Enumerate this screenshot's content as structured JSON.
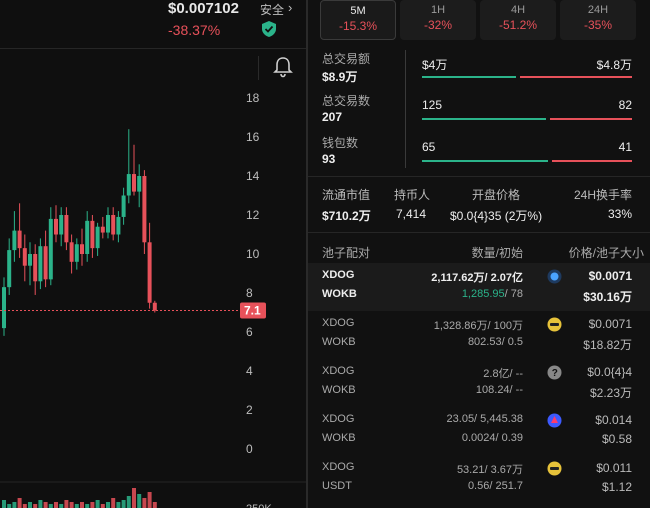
{
  "header": {
    "price": "$0.007102",
    "change": "-38.37%",
    "safety_label": "安全",
    "safety_arrow": "›"
  },
  "chart_data": {
    "type": "candlestick",
    "ylabels": [
      "18",
      "16",
      "14",
      "12",
      "10",
      "8",
      "6",
      "4",
      "2",
      "0"
    ],
    "current_price_label": "7.1",
    "bottom_partial_label": "250K",
    "candles": [
      {
        "o": 6.2,
        "h": 8.8,
        "l": 5.8,
        "c": 8.3
      },
      {
        "o": 8.3,
        "h": 10.8,
        "l": 7.9,
        "c": 10.2
      },
      {
        "o": 10.2,
        "h": 12.2,
        "l": 9.6,
        "c": 11.2
      },
      {
        "o": 11.2,
        "h": 12.6,
        "l": 9.8,
        "c": 10.3
      },
      {
        "o": 10.3,
        "h": 11.0,
        "l": 8.6,
        "c": 9.4
      },
      {
        "o": 9.4,
        "h": 10.6,
        "l": 8.4,
        "c": 10.0
      },
      {
        "o": 10.0,
        "h": 10.5,
        "l": 7.9,
        "c": 8.6
      },
      {
        "o": 8.6,
        "h": 10.8,
        "l": 8.2,
        "c": 10.4
      },
      {
        "o": 10.4,
        "h": 11.2,
        "l": 8.3,
        "c": 8.7
      },
      {
        "o": 8.7,
        "h": 12.4,
        "l": 8.4,
        "c": 11.8
      },
      {
        "o": 11.8,
        "h": 12.5,
        "l": 10.6,
        "c": 11.0
      },
      {
        "o": 11.0,
        "h": 12.4,
        "l": 10.4,
        "c": 12.0
      },
      {
        "o": 12.0,
        "h": 12.4,
        "l": 10.2,
        "c": 10.6
      },
      {
        "o": 10.6,
        "h": 11.0,
        "l": 9.0,
        "c": 9.6
      },
      {
        "o": 9.6,
        "h": 10.8,
        "l": 9.2,
        "c": 10.5
      },
      {
        "o": 10.5,
        "h": 11.3,
        "l": 9.4,
        "c": 10.0
      },
      {
        "o": 10.0,
        "h": 12.2,
        "l": 9.6,
        "c": 11.7
      },
      {
        "o": 11.7,
        "h": 12.0,
        "l": 9.8,
        "c": 10.3
      },
      {
        "o": 10.3,
        "h": 11.6,
        "l": 9.9,
        "c": 11.4
      },
      {
        "o": 11.4,
        "h": 11.9,
        "l": 10.8,
        "c": 11.1
      },
      {
        "o": 11.1,
        "h": 12.4,
        "l": 10.8,
        "c": 12.0
      },
      {
        "o": 12.0,
        "h": 12.4,
        "l": 10.7,
        "c": 11.0
      },
      {
        "o": 11.0,
        "h": 12.2,
        "l": 10.6,
        "c": 11.9
      },
      {
        "o": 11.9,
        "h": 13.4,
        "l": 11.5,
        "c": 13.0
      },
      {
        "o": 13.0,
        "h": 16.4,
        "l": 12.6,
        "c": 14.1
      },
      {
        "o": 14.1,
        "h": 15.6,
        "l": 13.0,
        "c": 13.2
      },
      {
        "o": 13.2,
        "h": 14.6,
        "l": 12.4,
        "c": 14.0
      },
      {
        "o": 14.0,
        "h": 14.3,
        "l": 10.0,
        "c": 10.6
      },
      {
        "o": 10.6,
        "h": 11.6,
        "l": 7.2,
        "c": 7.5
      },
      {
        "o": 7.5,
        "h": 7.6,
        "l": 7.0,
        "c": 7.1
      }
    ],
    "volumes": [
      0.4,
      0.2,
      0.3,
      0.5,
      0.2,
      0.3,
      0.2,
      0.4,
      0.3,
      0.2,
      0.3,
      0.2,
      0.4,
      0.3,
      0.2,
      0.3,
      0.2,
      0.3,
      0.4,
      0.2,
      0.3,
      0.5,
      0.3,
      0.4,
      0.6,
      1.0,
      0.7,
      0.5,
      0.8,
      0.3
    ]
  },
  "tabs": [
    {
      "label": "5M",
      "value": "-15.3%"
    },
    {
      "label": "1H",
      "value": "-32%"
    },
    {
      "label": "4H",
      "value": "-51.2%"
    },
    {
      "label": "24H",
      "value": "-35%"
    }
  ],
  "stats": {
    "volume_label": "总交易额",
    "volume_value": "$8.9万",
    "tx_label": "总交易数",
    "tx_value": "207",
    "wallet_label": "钱包数",
    "wallet_value": "93",
    "volume_buy": "$4万",
    "volume_sell": "$4.8万",
    "tx_buy": "125",
    "tx_sell": "82",
    "wallet_buy": "65",
    "wallet_sell": "41",
    "buy_ratios": [
      0.455,
      0.604,
      0.613
    ]
  },
  "info": {
    "circulating_label": "流通市值",
    "circulating_value": "$710.2万",
    "holders_label": "持币人",
    "holders_value": "7,414",
    "open_label": "开盘价格",
    "open_value": "$0.0{4}35 (2万%)",
    "turnover_label": "24H换手率",
    "turnover_value": "33%"
  },
  "pools": {
    "header_pair": "池子配对",
    "header_qty": "数量/初始",
    "header_price": "价格/池子大小",
    "rows": [
      {
        "a": "XDOG",
        "b": "WOKB",
        "qa": "2,117.62万/ 2.07亿",
        "qb_green": "1,285.95",
        "qb_rest": "/ 78",
        "price": "$0.0071",
        "size": "$30.16万",
        "icon": "dex-icon-1",
        "highlight": true
      },
      {
        "a": "XDOG",
        "b": "WOKB",
        "qa": "1,328.86万/ 100万",
        "qb_green": "",
        "qb_rest": "802.53/ 0.5",
        "price": "$0.0071",
        "size": "$18.82万",
        "icon": "dex-icon-2",
        "highlight": false
      },
      {
        "a": "XDOG",
        "b": "WOKB",
        "qa": "2.8亿/ --",
        "qb_green": "",
        "qb_rest": "108.24/ --",
        "price": "$0.0{4}4",
        "size": "$2.23万",
        "icon": "question-icon",
        "highlight": false
      },
      {
        "a": "XDOG",
        "b": "WOKB",
        "qa": "23.05/ 5,445.38",
        "qb_green": "",
        "qb_rest": "0.0024/ 0.39",
        "price": "$0.014",
        "size": "$0.58",
        "icon": "dex-icon-3",
        "highlight": false
      },
      {
        "a": "XDOG",
        "b": "USDT",
        "qa": "53.21/ 3.67万",
        "qb_green": "",
        "qb_rest": "0.56/ 251.7",
        "price": "$0.011",
        "size": "$1.12",
        "icon": "dex-icon-2",
        "highlight": false
      }
    ]
  },
  "colors": {
    "up": "#2bb38a",
    "down": "#e7515a",
    "bg": "#0f0f0f"
  }
}
